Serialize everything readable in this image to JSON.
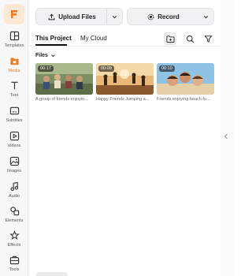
{
  "sidebar": {
    "items": [
      {
        "label": "Templates",
        "icon": "templates-icon"
      },
      {
        "label": "Media",
        "icon": "media-icon",
        "active": true
      },
      {
        "label": "Text",
        "icon": "text-icon"
      },
      {
        "label": "Subtitles",
        "icon": "subtitles-icon"
      },
      {
        "label": "Videos",
        "icon": "videos-icon"
      },
      {
        "label": "Images",
        "icon": "images-icon"
      },
      {
        "label": "Audio",
        "icon": "audio-icon"
      },
      {
        "label": "Elements",
        "icon": "elements-icon"
      },
      {
        "label": "Effects",
        "icon": "effects-icon"
      },
      {
        "label": "Tools",
        "icon": "tools-icon"
      }
    ]
  },
  "toolbar": {
    "upload_label": "Upload Files",
    "record_label": "Record"
  },
  "tabs": [
    {
      "label": "This Project",
      "active": true
    },
    {
      "label": "My Cloud",
      "active": false
    }
  ],
  "files": {
    "label": "Files",
    "items": [
      {
        "duration": "00:17",
        "caption": "A group of friends enjoyin..."
      },
      {
        "duration": "00:09",
        "caption": "Happy Friends Jumping a..."
      },
      {
        "duration": "00:10",
        "caption": "Friends enjoying beach fu..."
      }
    ]
  },
  "colors": {
    "accent": "#f07a1e",
    "brand_bg": "#fde8d4"
  }
}
